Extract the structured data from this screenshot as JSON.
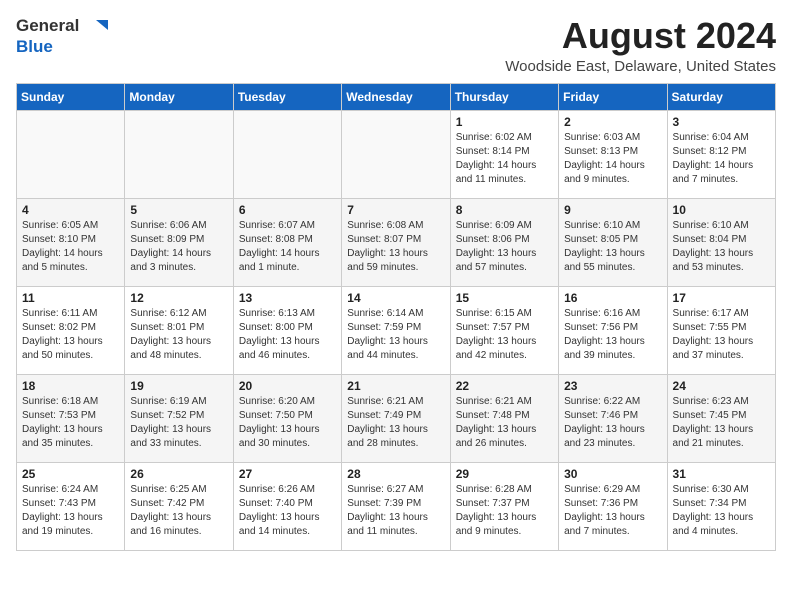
{
  "logo": {
    "general": "General",
    "blue": "Blue"
  },
  "title": "August 2024",
  "subtitle": "Woodside East, Delaware, United States",
  "headers": [
    "Sunday",
    "Monday",
    "Tuesday",
    "Wednesday",
    "Thursday",
    "Friday",
    "Saturday"
  ],
  "weeks": [
    [
      {
        "day": "",
        "lines": []
      },
      {
        "day": "",
        "lines": []
      },
      {
        "day": "",
        "lines": []
      },
      {
        "day": "",
        "lines": []
      },
      {
        "day": "1",
        "lines": [
          "Sunrise: 6:02 AM",
          "Sunset: 8:14 PM",
          "Daylight: 14 hours",
          "and 11 minutes."
        ]
      },
      {
        "day": "2",
        "lines": [
          "Sunrise: 6:03 AM",
          "Sunset: 8:13 PM",
          "Daylight: 14 hours",
          "and 9 minutes."
        ]
      },
      {
        "day": "3",
        "lines": [
          "Sunrise: 6:04 AM",
          "Sunset: 8:12 PM",
          "Daylight: 14 hours",
          "and 7 minutes."
        ]
      }
    ],
    [
      {
        "day": "4",
        "lines": [
          "Sunrise: 6:05 AM",
          "Sunset: 8:10 PM",
          "Daylight: 14 hours",
          "and 5 minutes."
        ]
      },
      {
        "day": "5",
        "lines": [
          "Sunrise: 6:06 AM",
          "Sunset: 8:09 PM",
          "Daylight: 14 hours",
          "and 3 minutes."
        ]
      },
      {
        "day": "6",
        "lines": [
          "Sunrise: 6:07 AM",
          "Sunset: 8:08 PM",
          "Daylight: 14 hours",
          "and 1 minute."
        ]
      },
      {
        "day": "7",
        "lines": [
          "Sunrise: 6:08 AM",
          "Sunset: 8:07 PM",
          "Daylight: 13 hours",
          "and 59 minutes."
        ]
      },
      {
        "day": "8",
        "lines": [
          "Sunrise: 6:09 AM",
          "Sunset: 8:06 PM",
          "Daylight: 13 hours",
          "and 57 minutes."
        ]
      },
      {
        "day": "9",
        "lines": [
          "Sunrise: 6:10 AM",
          "Sunset: 8:05 PM",
          "Daylight: 13 hours",
          "and 55 minutes."
        ]
      },
      {
        "day": "10",
        "lines": [
          "Sunrise: 6:10 AM",
          "Sunset: 8:04 PM",
          "Daylight: 13 hours",
          "and 53 minutes."
        ]
      }
    ],
    [
      {
        "day": "11",
        "lines": [
          "Sunrise: 6:11 AM",
          "Sunset: 8:02 PM",
          "Daylight: 13 hours",
          "and 50 minutes."
        ]
      },
      {
        "day": "12",
        "lines": [
          "Sunrise: 6:12 AM",
          "Sunset: 8:01 PM",
          "Daylight: 13 hours",
          "and 48 minutes."
        ]
      },
      {
        "day": "13",
        "lines": [
          "Sunrise: 6:13 AM",
          "Sunset: 8:00 PM",
          "Daylight: 13 hours",
          "and 46 minutes."
        ]
      },
      {
        "day": "14",
        "lines": [
          "Sunrise: 6:14 AM",
          "Sunset: 7:59 PM",
          "Daylight: 13 hours",
          "and 44 minutes."
        ]
      },
      {
        "day": "15",
        "lines": [
          "Sunrise: 6:15 AM",
          "Sunset: 7:57 PM",
          "Daylight: 13 hours",
          "and 42 minutes."
        ]
      },
      {
        "day": "16",
        "lines": [
          "Sunrise: 6:16 AM",
          "Sunset: 7:56 PM",
          "Daylight: 13 hours",
          "and 39 minutes."
        ]
      },
      {
        "day": "17",
        "lines": [
          "Sunrise: 6:17 AM",
          "Sunset: 7:55 PM",
          "Daylight: 13 hours",
          "and 37 minutes."
        ]
      }
    ],
    [
      {
        "day": "18",
        "lines": [
          "Sunrise: 6:18 AM",
          "Sunset: 7:53 PM",
          "Daylight: 13 hours",
          "and 35 minutes."
        ]
      },
      {
        "day": "19",
        "lines": [
          "Sunrise: 6:19 AM",
          "Sunset: 7:52 PM",
          "Daylight: 13 hours",
          "and 33 minutes."
        ]
      },
      {
        "day": "20",
        "lines": [
          "Sunrise: 6:20 AM",
          "Sunset: 7:50 PM",
          "Daylight: 13 hours",
          "and 30 minutes."
        ]
      },
      {
        "day": "21",
        "lines": [
          "Sunrise: 6:21 AM",
          "Sunset: 7:49 PM",
          "Daylight: 13 hours",
          "and 28 minutes."
        ]
      },
      {
        "day": "22",
        "lines": [
          "Sunrise: 6:21 AM",
          "Sunset: 7:48 PM",
          "Daylight: 13 hours",
          "and 26 minutes."
        ]
      },
      {
        "day": "23",
        "lines": [
          "Sunrise: 6:22 AM",
          "Sunset: 7:46 PM",
          "Daylight: 13 hours",
          "and 23 minutes."
        ]
      },
      {
        "day": "24",
        "lines": [
          "Sunrise: 6:23 AM",
          "Sunset: 7:45 PM",
          "Daylight: 13 hours",
          "and 21 minutes."
        ]
      }
    ],
    [
      {
        "day": "25",
        "lines": [
          "Sunrise: 6:24 AM",
          "Sunset: 7:43 PM",
          "Daylight: 13 hours",
          "and 19 minutes."
        ]
      },
      {
        "day": "26",
        "lines": [
          "Sunrise: 6:25 AM",
          "Sunset: 7:42 PM",
          "Daylight: 13 hours",
          "and 16 minutes."
        ]
      },
      {
        "day": "27",
        "lines": [
          "Sunrise: 6:26 AM",
          "Sunset: 7:40 PM",
          "Daylight: 13 hours",
          "and 14 minutes."
        ]
      },
      {
        "day": "28",
        "lines": [
          "Sunrise: 6:27 AM",
          "Sunset: 7:39 PM",
          "Daylight: 13 hours",
          "and 11 minutes."
        ]
      },
      {
        "day": "29",
        "lines": [
          "Sunrise: 6:28 AM",
          "Sunset: 7:37 PM",
          "Daylight: 13 hours",
          "and 9 minutes."
        ]
      },
      {
        "day": "30",
        "lines": [
          "Sunrise: 6:29 AM",
          "Sunset: 7:36 PM",
          "Daylight: 13 hours",
          "and 7 minutes."
        ]
      },
      {
        "day": "31",
        "lines": [
          "Sunrise: 6:30 AM",
          "Sunset: 7:34 PM",
          "Daylight: 13 hours",
          "and 4 minutes."
        ]
      }
    ]
  ]
}
